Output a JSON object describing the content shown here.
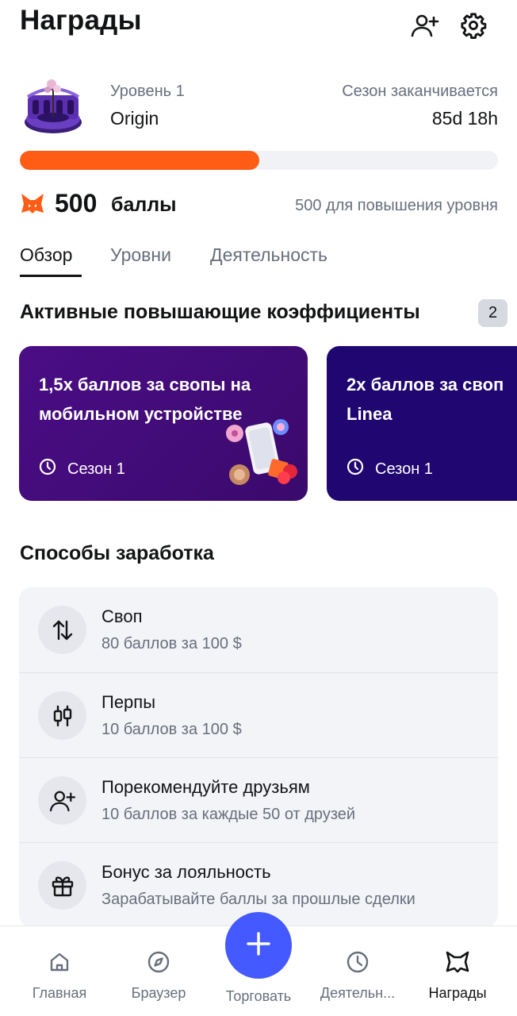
{
  "header": {
    "title": "Награды",
    "icons": [
      "add-user-icon",
      "gear-icon"
    ]
  },
  "level": {
    "label": "Уровень 1",
    "name": "Origin",
    "season_label": "Сезон заканчивается",
    "season_remaining": "85d 18h",
    "progress_percent": 50
  },
  "points": {
    "value": "500",
    "unit": "баллы",
    "to_next_level": "500 для повышения уровня"
  },
  "tabs": [
    {
      "label": "Обзор",
      "active": true
    },
    {
      "label": "Уровни",
      "active": false
    },
    {
      "label": "Деятельность",
      "active": false
    }
  ],
  "boosts": {
    "title": "Активные повышающие коэффициенты",
    "count": "2",
    "cards": [
      {
        "title_line1": "1,5x баллов за свопы на",
        "title_line2": "мобильном устройстве",
        "season": "Сезон 1",
        "color": "#4b0d86"
      },
      {
        "title_line1": "2x баллов за своп",
        "title_line2": "Linea",
        "season": "Сезон 1",
        "color": "#1f0670"
      }
    ]
  },
  "earn": {
    "title": "Способы заработка",
    "items": [
      {
        "title": "Своп",
        "subtitle": "80 баллов за 100 $",
        "icon": "swap-arrows-icon"
      },
      {
        "title": "Перпы",
        "subtitle": "10 баллов за 100 $",
        "icon": "candlestick-icon"
      },
      {
        "title": "Порекомендуйте друзьям",
        "subtitle": "10 баллов за каждые 50 от друзей",
        "icon": "add-user-icon"
      },
      {
        "title": "Бонус за лояльность",
        "subtitle": "Зарабатывайте баллы за прошлые сделки",
        "icon": "gift-icon"
      }
    ]
  },
  "bottom_nav": {
    "items": [
      {
        "label": "Главная",
        "icon": "home-icon"
      },
      {
        "label": "Браузер",
        "icon": "compass-icon"
      },
      {
        "label": "Торговать",
        "icon": "plus-icon"
      },
      {
        "label": "Деятельн...",
        "icon": "clock-icon"
      },
      {
        "label": "Награды",
        "icon": "fox-icon",
        "active": true
      }
    ]
  },
  "colors": {
    "accent_orange": "#ff5c16",
    "fab_blue": "#4459ff",
    "muted_text": "#686e7d"
  }
}
